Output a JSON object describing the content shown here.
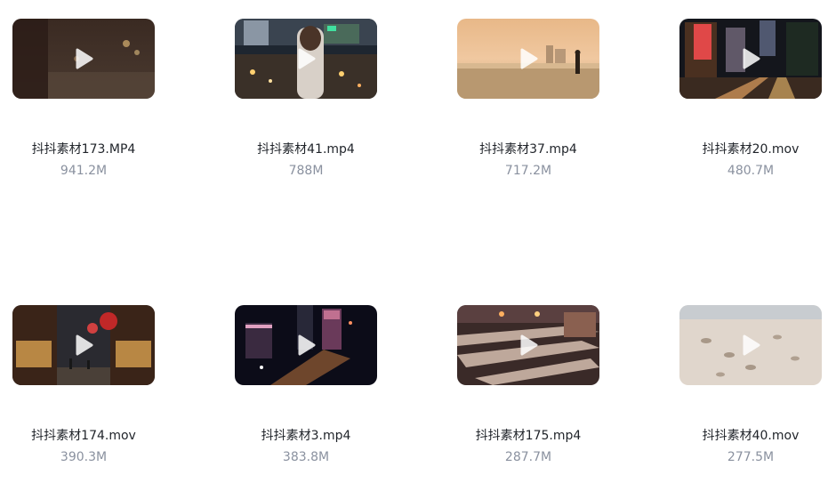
{
  "files": [
    {
      "name": "抖抖素材173.MP4",
      "size": "941.2M",
      "thumb_icon": "street-night-blur"
    },
    {
      "name": "抖抖素材41.mp4",
      "size": "788M",
      "thumb_icon": "city-overlook-woman"
    },
    {
      "name": "抖抖素材37.mp4",
      "size": "717.2M",
      "thumb_icon": "beach-sunset"
    },
    {
      "name": "抖抖素材20.mov",
      "size": "480.7M",
      "thumb_icon": "city-street-night"
    },
    {
      "name": "抖抖素材174.mov",
      "size": "390.3M",
      "thumb_icon": "old-street-lanterns"
    },
    {
      "name": "抖抖素材3.mp4",
      "size": "383.8M",
      "thumb_icon": "city-aerial-night"
    },
    {
      "name": "抖抖素材175.mp4",
      "size": "287.7M",
      "thumb_icon": "crosswalk-evening"
    },
    {
      "name": "抖抖素材40.mov",
      "size": "277.5M",
      "thumb_icon": "sand-footprints"
    }
  ]
}
